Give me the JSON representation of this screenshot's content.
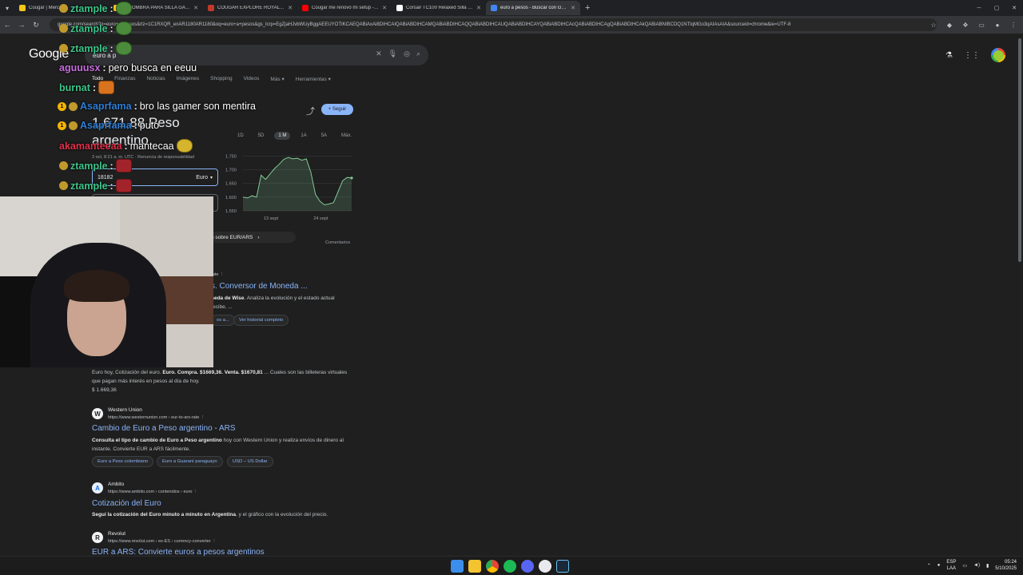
{
  "browser": {
    "tabs": [
      {
        "title": "Cougar | Merca...",
        "color": "#f5c518"
      },
      {
        "title": "ALFOMBRA PARA SILLA GAMER...",
        "color": "#f5c518"
      },
      {
        "title": "COUGAR EXPLORE ROYAL - Ga...",
        "color": "#c0392b"
      },
      {
        "title": "Cougar me renovó mi setup - Y...",
        "color": "#ff0000"
      },
      {
        "title": "Corsair TC100 Relaxed Silla para...",
        "color": "#ffffff"
      },
      {
        "title": "euro a pesos - Buscar con Goo...",
        "color": "#4285f4",
        "active": true
      }
    ],
    "new_tab": "+",
    "url": "google.com/search?q=euro+a+pesos&rlz=1C1RXQR_enAR1180AR1180&oq=euro+a+pesos&gs_lcrp=EgZjaHJvbWUyBggAEEUYOTIKCAEQABiAxAi8DIHCAIQABiABDIHCAMQABiABDIHCAQQABiABDIHCAUQABiABDIHCAYQABiABDIHCAcQABiABDIHCAgQABiABDIHCAkQABiABNIBCDQ1NTlqMGo3qAIAsAIA&sourceid=chrome&ie=UTF-8"
  },
  "google": {
    "logo": "Google",
    "query": "euro a p",
    "tabs": [
      "Todo",
      "Finanzas",
      "Noticias",
      "Imágenes",
      "Shopping",
      "Videos",
      "Más ▾",
      "Herramientas ▾"
    ],
    "follow_label": "+ Seguir",
    "rate_value": "1.671,88 Peso argentino",
    "rate_date": "3 oct, 8:21 a. m. UTC · Renuncia de responsabilidad",
    "converter": {
      "amount": "18182",
      "currency": "Euro"
    },
    "ranges": [
      "1D",
      "5D",
      "1 M",
      "1A",
      "5A",
      "Máx."
    ],
    "selected_range": "1 M",
    "more_about": "n sobre EUR/ARS",
    "comments": "Comentarios",
    "wise": {
      "source": "rate",
      "title": "s. Conversor de Moneda ...",
      "snippet_bold": "neda de Wise",
      "snippet_rest": ". Analiza la evolución y el estado actual",
      "snippet_line2": "recibe, ...",
      "chip1": "os a...",
      "chip2": "Ver historial completo"
    },
    "snippet": {
      "pre": "Euro hoy, Cotización del euro. ",
      "bold": "Euro. Compra. $1669,36. Venta. $1670,81",
      "post": " ... Cuales son las billeteras virtuales que pagan más interés en pesos al día de hoy.",
      "price": "$ 1.669,36"
    },
    "results": [
      {
        "icon": "W",
        "name": "Western Union",
        "url": "https://www.westernunion.com › eur-to-ars-rate",
        "title": "Cambio de Euro a Peso argentino - ARS",
        "desc_bold": "Consulta el tipo de cambio de Euro a Peso argentino",
        "desc_rest": " hoy con Western Union y realiza envíos de dinero al instante. Convierte EUR a ARS fácilmente.",
        "chips": [
          "Euro a Peso colombiano",
          "Euro a Guaraní paraguayo",
          "USD – US Dollar"
        ]
      },
      {
        "icon": "A",
        "name": "Ambito",
        "url": "https://www.ambito.com › contenidos › euro",
        "title": "Cotización del Euro",
        "desc_bold": "Seguí la cotización del Euro minuto a minuto en Argentina",
        "desc_rest": ", y el gráfico con la evolución del precio."
      },
      {
        "icon": "R",
        "name": "Revolut",
        "url": "https://www.revolut.com › es-ES › currency-converter",
        "title": "EUR a ARS: Convierte euros a pesos argentinos"
      }
    ]
  },
  "chart_data": {
    "type": "line",
    "x_ticks": [
      "13 sept",
      "24 sept"
    ],
    "y_ticks": [
      1750,
      1700,
      1650,
      1600,
      1550
    ],
    "ylim": [
      1550,
      1760
    ],
    "series": [
      {
        "color": "#81c995",
        "values": [
          1600,
          1597,
          1605,
          1600,
          1680,
          1665,
          1685,
          1705,
          1720,
          1738,
          1745,
          1740,
          1742,
          1735,
          1740,
          1690,
          1610,
          1585,
          1572,
          1575,
          1580,
          1620,
          1660,
          1672,
          1670
        ]
      }
    ]
  },
  "chat": [
    {
      "user": "ztample",
      "color": "#3ec58a",
      "msg": ""
    },
    {
      "user": "ztample",
      "color": "#3ec58a",
      "msg": ""
    },
    {
      "user": "ztample",
      "color": "#3ec58a",
      "msg": ""
    },
    {
      "user": "aguuusx",
      "color": "#c86ee0",
      "msg": "pero busca en eeuu"
    },
    {
      "user": "burnat",
      "color": "#3ec58a",
      "msg": ""
    },
    {
      "user": "Asaprfama",
      "color": "#2f7fd6",
      "msg": "bro las gamer son mentira"
    },
    {
      "user": "Asaprfama",
      "color": "#2f7fd6",
      "msg": "puto"
    },
    {
      "user": "akamantecaa",
      "color": "#e0304a",
      "msg": "mantecaa"
    },
    {
      "user": "ztample",
      "color": "#3ec58a",
      "msg": ""
    },
    {
      "user": "ztample",
      "color": "#3ec58a",
      "msg": ""
    }
  ],
  "taskbar": {
    "lang_top": "ESP",
    "lang_bottom": "LAA",
    "time": "05:24",
    "date": "5/10/2025"
  }
}
